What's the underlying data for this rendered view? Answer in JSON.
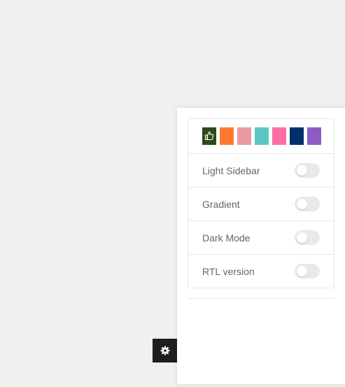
{
  "colors": {
    "swatches": [
      {
        "name": "dark-green",
        "hex": "#2e4a1a",
        "selected": true
      },
      {
        "name": "orange",
        "hex": "#ff7a2f",
        "selected": false
      },
      {
        "name": "pink",
        "hex": "#e89ba0",
        "selected": false
      },
      {
        "name": "teal",
        "hex": "#5ac8c0",
        "selected": false
      },
      {
        "name": "hot-pink",
        "hex": "#ff6fa3",
        "selected": false
      },
      {
        "name": "navy",
        "hex": "#00306b",
        "selected": false
      },
      {
        "name": "purple",
        "hex": "#8b5cc5",
        "selected": false
      }
    ],
    "selected_icon": "thumbs-up-icon"
  },
  "options": [
    {
      "label": "Light Sidebar",
      "enabled": false
    },
    {
      "label": "Gradient",
      "enabled": false
    },
    {
      "label": "Dark Mode",
      "enabled": false
    },
    {
      "label": "RTL version",
      "enabled": false
    }
  ],
  "toggle_button": {
    "icon": "gear-icon"
  }
}
